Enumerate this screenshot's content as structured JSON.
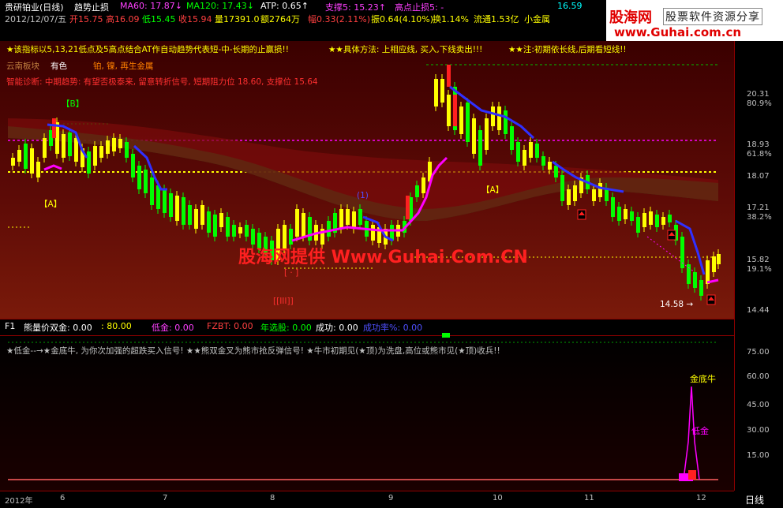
{
  "header": {
    "row1": [
      {
        "text": "贵研铂业(日线)",
        "color": "#ffffff"
      },
      {
        "text": "趋势止损",
        "color": "#ffffff"
      },
      {
        "text": "MA60: 17.87↓",
        "color": "#ff40ff"
      },
      {
        "text": "MA120: 17.43↓",
        "color": "#00ff00"
      },
      {
        "text": "ATP: 0.65↑",
        "color": "#ffffff"
      },
      {
        "text": "支撑5: 15.23↑",
        "color": "#ff40ff"
      },
      {
        "text": "高点止损5: -",
        "color": "#ff40ff"
      },
      {
        "text": "16.59",
        "color": "#00ffff"
      }
    ],
    "row2": [
      {
        "text": "2012/12/07/五",
        "color": "#c0c0c0"
      },
      {
        "text": "开15.75",
        "color": "#ff4040"
      },
      {
        "text": "高16.09",
        "color": "#ff4040"
      },
      {
        "text": "低15.45",
        "color": "#00ff00"
      },
      {
        "text": "收15.94",
        "color": "#ff4040"
      },
      {
        "text": "量17391.0",
        "color": "#ffff00"
      },
      {
        "text": "额2764万",
        "color": "#ffff00"
      },
      {
        "text": "幅0.33(2.11%)",
        "color": "#ff4040"
      },
      {
        "text": "振0.64(4.10%)",
        "color": "#ffff00"
      },
      {
        "text": "换1.14%",
        "color": "#ffff00"
      },
      {
        "text": "流通1.53亿",
        "color": "#ffff00"
      },
      {
        "text": "小金属",
        "color": "#ffff00"
      }
    ]
  },
  "logo": {
    "brand": "股海网",
    "slogan": "股票软件资源分享",
    "url": "www.Guhai.com.cn"
  },
  "banner": {
    "line1": "★该指标以5,13,21低点及5高点结合AT作自动趋势代表短-中-长期的止赢损!!",
    "line1b": "★★具体方法: 上相应线, 买入,下线卖出!!!",
    "line1c": "★★注:初期依长线,后期看短线!!",
    "sector_label": "云南板块",
    "sector_value": "有色",
    "sector_metals": "铂, 镍, 再生金属",
    "diagnosis": "智能诊断: 中期趋势: 有望否极泰来, 留意转折信号, 短期阻力位 18.60, 支撑位 15.64"
  },
  "watermark": "股海网提供 Www.Guhai.Com.CN",
  "chart_labels": {
    "B_box": "【B】",
    "A_box_left": "【A】",
    "A_box_mid": "【A】",
    "III_box": "[[III]]",
    "dot_box": "[ · ]",
    "one_label": "(1)",
    "low_label": "14.58",
    "s_mark": "S",
    "b_mark": "B"
  },
  "price_axis": [
    {
      "value": "20.31",
      "color": "#c0c0c0"
    },
    {
      "value": "80.9%",
      "color": "#c0c0c0"
    },
    {
      "value": "18.93",
      "color": "#c0c0c0"
    },
    {
      "value": "61.8%",
      "color": "#c0c0c0"
    },
    {
      "value": "18.07",
      "color": "#c0c0c0"
    },
    {
      "value": "17.21",
      "color": "#c0c0c0"
    },
    {
      "value": "38.2%",
      "color": "#c0c0c0"
    },
    {
      "value": "15.82",
      "color": "#c0c0c0"
    },
    {
      "value": "19.1%",
      "color": "#c0c0c0"
    },
    {
      "value": "14.44",
      "color": "#c0c0c0"
    }
  ],
  "indicator_bar": {
    "name": "F1",
    "items": [
      {
        "text": "熊量价双金: 0.00",
        "color": "#ffffff"
      },
      {
        "text": ": 80.00",
        "color": "#ffff00"
      },
      {
        "text": "低金: 0.00",
        "color": "#ff40ff"
      },
      {
        "text": "FZBT: 0.00",
        "color": "#ff4040"
      },
      {
        "text": "年选股: 0.00",
        "color": "#00ff00"
      },
      {
        "text": "成功: 0.00",
        "color": "#ffffff"
      },
      {
        "text": "成功率%: 0.00",
        "color": "#5050ff"
      }
    ]
  },
  "lower_panel": {
    "note": "★低金--→★金底牛, 为你次加强的超跌买入信号! ★★熊双金叉为熊市抢反弹信号! ★牛市初期见(★顶)为洗盘,高位或熊市见(★顶)收兵!!",
    "gold_bull": "金底牛",
    "low_gold": "低金",
    "axis": [
      "75.00",
      "60.00",
      "45.00",
      "30.00",
      "15.00"
    ]
  },
  "x_axis": {
    "labels": [
      "2012年",
      "6",
      "7",
      "8",
      "9",
      "10",
      "11",
      "12"
    ],
    "period": "日线"
  }
}
